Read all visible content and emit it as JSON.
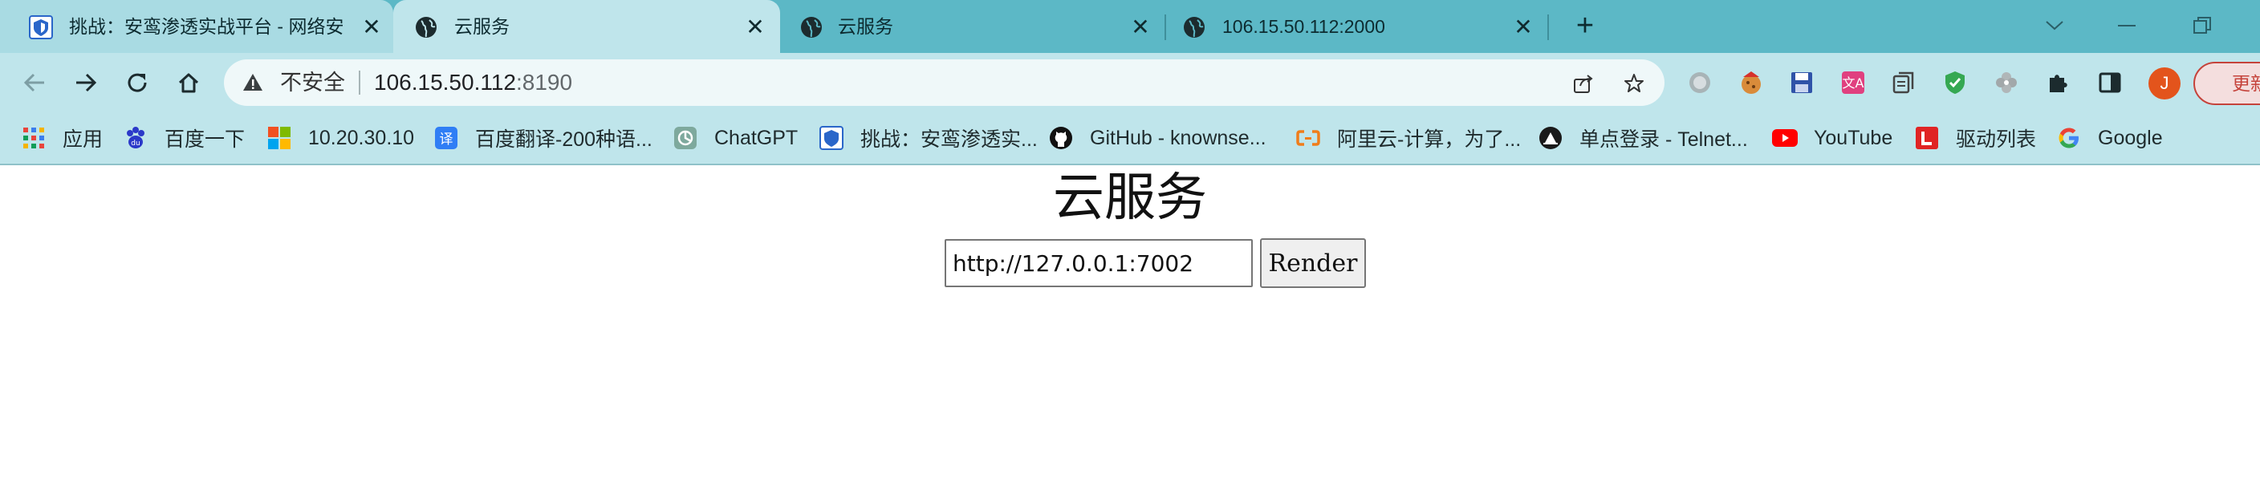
{
  "tabs": [
    {
      "title": "挑战：安鸾渗透实战平台 - 网络安",
      "icon": "shield-favicon"
    },
    {
      "title": "云服务",
      "icon": "globe-favicon"
    },
    {
      "title": "云服务",
      "icon": "globe-favicon"
    },
    {
      "title": "106.15.50.112:2000",
      "icon": "globe-favicon"
    }
  ],
  "toolbar": {
    "security_label": "不安全",
    "url_host": "106.15.50.112",
    "url_port": ":8190",
    "update_label": "更新",
    "profile_initial": "J"
  },
  "bookmarks": [
    {
      "label": "应用",
      "icon": "apps-grid-icon"
    },
    {
      "label": "百度一下",
      "icon": "baidu-icon"
    },
    {
      "label": "10.20.30.10",
      "icon": "windows-icon"
    },
    {
      "label": "百度翻译-200种语...",
      "icon": "translate-icon"
    },
    {
      "label": "ChatGPT",
      "icon": "chatgpt-icon"
    },
    {
      "label": "挑战：安鸾渗透实...",
      "icon": "shield-icon"
    },
    {
      "label": "GitHub - knownse...",
      "icon": "github-icon"
    },
    {
      "label": "阿里云-计算，为了...",
      "icon": "aliyun-icon"
    },
    {
      "label": "单点登录 - Telnet...",
      "icon": "telnet-icon"
    },
    {
      "label": "YouTube",
      "icon": "youtube-icon"
    },
    {
      "label": "驱动列表",
      "icon": "driver-icon"
    },
    {
      "label": "Google",
      "icon": "google-icon"
    }
  ],
  "page": {
    "heading": "云服务",
    "input_value": "http://127.0.0.1:7002",
    "button_label": "Render"
  }
}
